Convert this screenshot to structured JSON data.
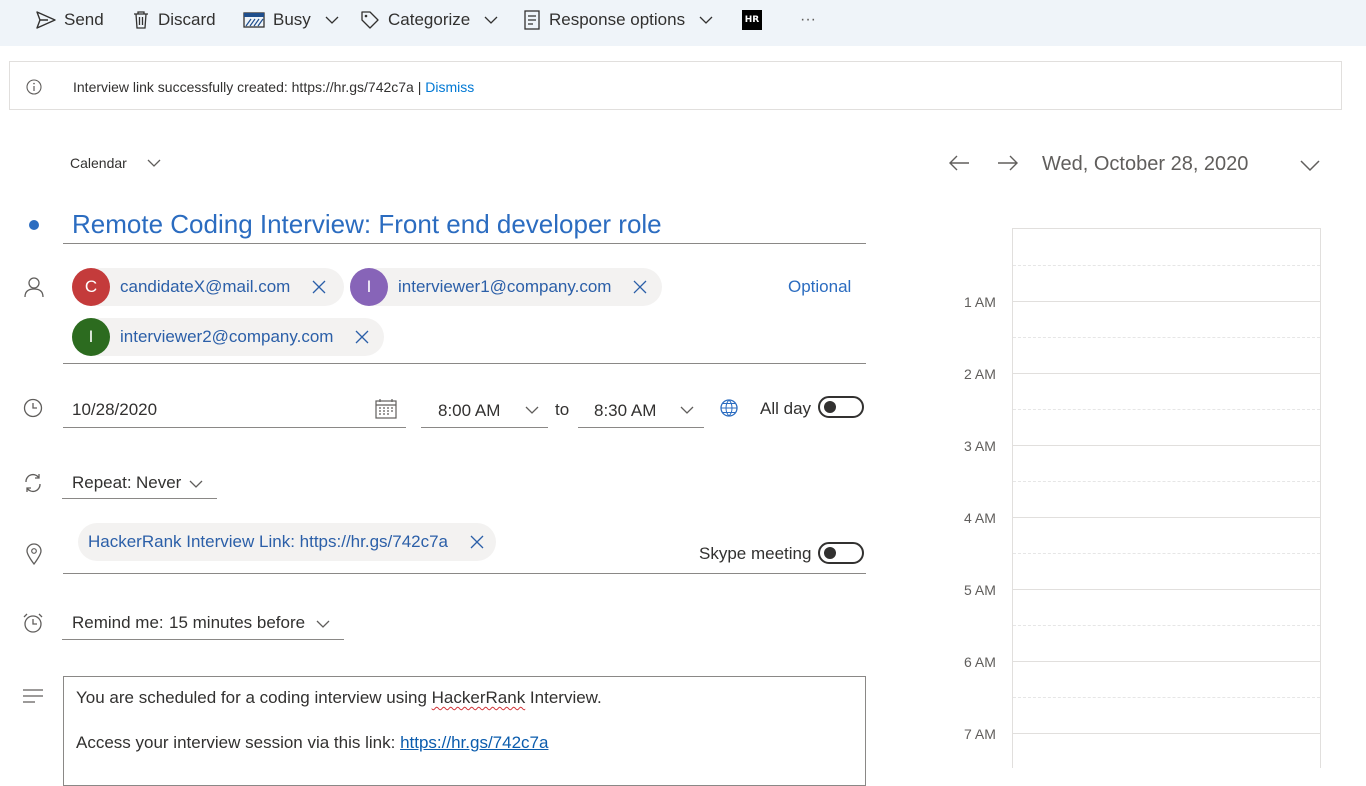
{
  "toolbar": {
    "send": "Send",
    "discard": "Discard",
    "busy": "Busy",
    "categorize": "Categorize",
    "response_options": "Response options",
    "app_badge": "HR",
    "more": "···"
  },
  "banner": {
    "message": "Interview link successfully created: https://hr.gs/742c7a | ",
    "dismiss": "Dismiss"
  },
  "form": {
    "calendar_label": "Calendar",
    "title": "Remote Coding Interview: Front end developer role",
    "attendees": [
      {
        "initial": "C",
        "email": "candidateX@mail.com",
        "color": "#c43b3b"
      },
      {
        "initial": "I",
        "email": "interviewer1@company.com",
        "color": "#8764b8"
      },
      {
        "initial": "I",
        "email": "interviewer2@company.com",
        "color": "#2c6b1f"
      }
    ],
    "optional_label": "Optional",
    "start_date": "10/28/2020",
    "start_time": "8:00 AM",
    "to_label": "to",
    "end_time": "8:30 AM",
    "all_day_label": "All day",
    "repeat_label": "Repeat:",
    "repeat_value": "Never",
    "location_chip": "HackerRank Interview Link: https://hr.gs/742c7a",
    "skype_label": "Skype meeting",
    "remind_label": "Remind me:",
    "remind_value": "15 minutes before",
    "body_line1_prefix": "You are scheduled for a coding interview using ",
    "body_line1_brand": "HackerRank",
    "body_line1_suffix": " Interview.",
    "body_line2_prefix": "Access your interview session via this link: ",
    "body_line2_link": "https://hr.gs/742c7a"
  },
  "calendar": {
    "date_label": "Wed, October 28, 2020",
    "hours": [
      "1 AM",
      "2 AM",
      "3 AM",
      "4 AM",
      "5 AM",
      "6 AM",
      "7 AM"
    ]
  },
  "colors": {
    "accent": "#0078d4",
    "title_blue": "#2b6cc0",
    "toolbar_bg": "#eff4f9"
  }
}
